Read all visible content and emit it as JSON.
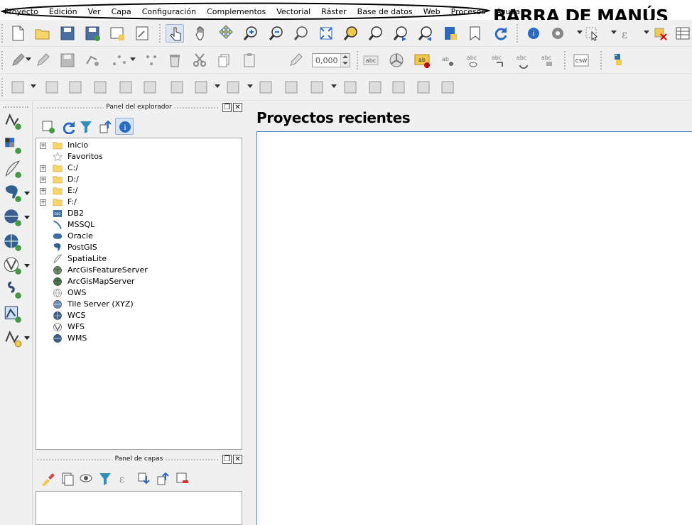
{
  "menubar": {
    "items": [
      "Proyecto",
      "Edición",
      "Ver",
      "Capa",
      "Configuración",
      "Complementos",
      "Vectorial",
      "Ráster",
      "Base de datos",
      "Web",
      "Procesos",
      "Ayuda"
    ],
    "annotation": "BARRA DE MANÚS"
  },
  "toolbar1": {
    "icons": [
      "new-project-icon",
      "open-project-icon",
      "save-project-icon",
      "save-project-as-icon",
      "new-print-layout-icon",
      "layout-manager-icon",
      "touch-zoom-icon",
      "pan-icon",
      "pan-to-selection-icon",
      "zoom-in-icon",
      "zoom-out-icon",
      "zoom-native-icon",
      "zoom-full-icon",
      "zoom-to-selection-icon",
      "zoom-to-layer-icon",
      "zoom-last-icon",
      "zoom-next-icon",
      "new-map-view-icon",
      "new-bookmark-icon",
      "refresh-icon",
      "identify-icon",
      "measure-icon",
      "select-features-icon",
      "select-by-value-icon",
      "deselect-icon",
      "attribute-table-icon"
    ]
  },
  "toolbar2": {
    "icons": [
      "digitize-pencil-icon",
      "edit-pencil-icon",
      "save-edits-icon",
      "add-feature-icon",
      "node-tool-icon",
      "move-feature-icon",
      "delete-selected-icon",
      "cut-features-icon",
      "copy-features-icon",
      "paste-features-icon",
      "rotate-point-icon",
      "label-toolbar-icon",
      "diagram-icon",
      "highlight-label-icon",
      "pin-label-icon",
      "show-hide-label-icon",
      "move-label-icon",
      "rotate-label-icon",
      "change-label-icon",
      "csw-icon",
      "python-icon"
    ],
    "rotation_value": "0,000"
  },
  "toolbar3": {
    "icons": [
      "simplify-icon",
      "add-ring-icon",
      "add-part-icon",
      "fill-ring-icon",
      "delete-ring-icon",
      "delete-part-icon",
      "reshape-icon",
      "offset-curve-icon",
      "split-features-icon",
      "split-parts-icon",
      "merge-features-icon",
      "merge-attributes-icon",
      "rotate-symbol-icon",
      "align-ring-icon",
      "offset-j-icon",
      "offset-d-icon",
      "offset-f-icon",
      "trace-icon"
    ]
  },
  "left_toolbar": {
    "icons": [
      "add-vector-layer-icon",
      "add-raster-layer-icon",
      "add-spatialite-layer-icon",
      "add-postgis-layer-icon",
      "add-wms-layer-icon",
      "add-wcs-layer-icon",
      "add-wfs-layer-icon",
      "add-delimited-text-icon",
      "add-virtual-layer-icon",
      "new-shapefile-icon"
    ]
  },
  "explorer_panel": {
    "title": "Panel del explorador",
    "tools": [
      "add-selected-icon",
      "refresh-icon",
      "filter-icon",
      "collapse-all-icon",
      "info-icon"
    ],
    "items": [
      {
        "label": "Inicio",
        "icon": "folder-icon",
        "expandable": true
      },
      {
        "label": "Favoritos",
        "icon": "star-icon",
        "expandable": false
      },
      {
        "label": "C:/",
        "icon": "folder-icon",
        "expandable": true
      },
      {
        "label": "D:/",
        "icon": "folder-icon",
        "expandable": true
      },
      {
        "label": "E:/",
        "icon": "folder-icon",
        "expandable": true
      },
      {
        "label": "F:/",
        "icon": "folder-icon",
        "expandable": true
      },
      {
        "label": "DB2",
        "icon": "db2-icon",
        "expandable": false
      },
      {
        "label": "MSSQL",
        "icon": "mssql-icon",
        "expandable": false
      },
      {
        "label": "Oracle",
        "icon": "oracle-icon",
        "expandable": false
      },
      {
        "label": "PostGIS",
        "icon": "postgis-icon",
        "expandable": false
      },
      {
        "label": "SpatiaLite",
        "icon": "spatialite-icon",
        "expandable": false
      },
      {
        "label": "ArcGisFeatureServer",
        "icon": "arcgis-feature-icon",
        "expandable": false
      },
      {
        "label": "ArcGisMapServer",
        "icon": "arcgis-map-icon",
        "expandable": false
      },
      {
        "label": "OWS",
        "icon": "ows-icon",
        "expandable": false
      },
      {
        "label": "Tile Server (XYZ)",
        "icon": "xyz-icon",
        "expandable": false
      },
      {
        "label": "WCS",
        "icon": "wcs-icon",
        "expandable": false
      },
      {
        "label": "WFS",
        "icon": "wfs-icon",
        "expandable": false
      },
      {
        "label": "WMS",
        "icon": "wms-icon",
        "expandable": false
      }
    ]
  },
  "layers_panel": {
    "title": "Panel de capas",
    "tools": [
      "style-icon",
      "add-group-icon",
      "visibility-icon",
      "filter-legend-icon",
      "expression-filter-icon",
      "expand-all-icon",
      "collapse-all-icon",
      "remove-layer-icon"
    ]
  },
  "main": {
    "title": "Proyectos recientes"
  },
  "colors": {
    "folder": "#f7d56a",
    "accent": "#4a7fc1",
    "postgis_blue": "#2e5f8f",
    "green": "#3f9b3f"
  }
}
